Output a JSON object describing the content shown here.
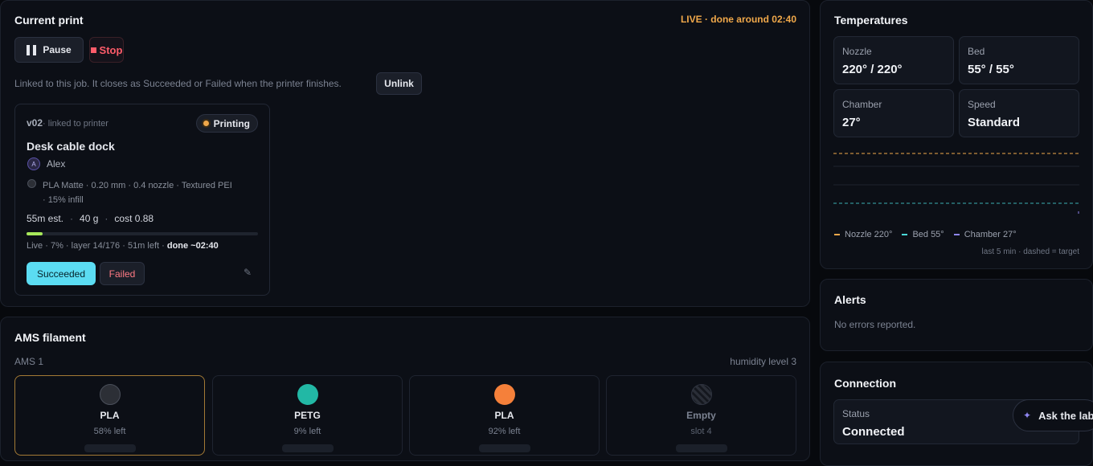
{
  "current_print": {
    "title": "Current print",
    "live_status": "LIVE · done around 02:40",
    "pause_label": "Pause",
    "stop_label": "Stop",
    "linked_note": "Linked to this job. It closes as Succeeded or Failed when the printer finishes.",
    "unlink_label": "Unlink",
    "job": {
      "version": "v02",
      "linked_text": "· linked to printer",
      "status": "Printing",
      "name": "Desk cable dock",
      "avatar_letter": "A",
      "owner": "Alex",
      "settings_line1": "PLA Matte · 0.20 mm · 0.4 nozzle · Textured PEI",
      "settings_line2": "· 15% infill",
      "est": "55m est.",
      "weight": "40 g",
      "cost": "cost 0.88",
      "progress_fraction": 0.07,
      "live_line": "Live · 7% · layer 14/176 · 51m left · ",
      "done_text": "done ~02:40",
      "succeeded_label": "Succeeded",
      "failed_label": "Failed"
    }
  },
  "ams": {
    "title": "AMS filament",
    "unit": "AMS 1",
    "humidity": "humidity level 3",
    "slots": [
      {
        "name": "PLA",
        "sub": "58% left",
        "color": "#2c2f36"
      },
      {
        "name": "PETG",
        "sub": "9% left",
        "color": "#22b8a5"
      },
      {
        "name": "PLA",
        "sub": "92% left",
        "color": "#f5803a"
      },
      {
        "name": "Empty",
        "sub": "slot 4",
        "color": "empty"
      }
    ]
  },
  "temperatures": {
    "title": "Temperatures",
    "tiles": [
      {
        "label": "Nozzle",
        "value": "220° / 220°"
      },
      {
        "label": "Bed",
        "value": "55° / 55°"
      },
      {
        "label": "Chamber",
        "value": "27°"
      },
      {
        "label": "Speed",
        "value": "Standard"
      }
    ],
    "legend": [
      {
        "label": "Nozzle 220°",
        "color": "#f0a84a"
      },
      {
        "label": "Bed 55°",
        "color": "#4ad8d8"
      },
      {
        "label": "Chamber 27°",
        "color": "#8f86f0"
      }
    ],
    "footnote": "last 5 min · dashed = target"
  },
  "alerts": {
    "title": "Alerts",
    "text": "No errors reported."
  },
  "connection": {
    "title": "Connection",
    "status_label": "Status",
    "status_value": "Connected"
  },
  "assistant": {
    "label": "Ask the lab"
  }
}
